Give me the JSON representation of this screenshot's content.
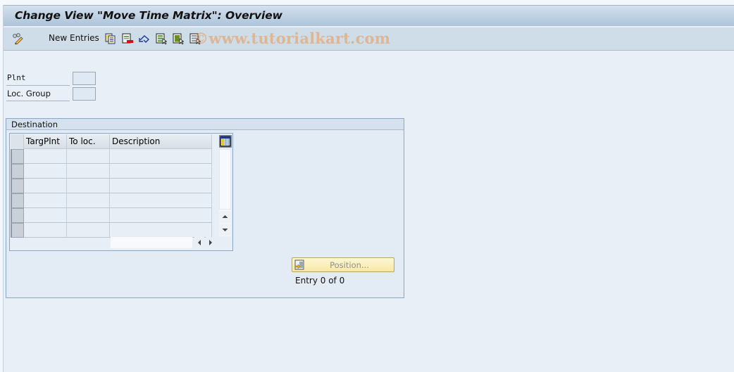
{
  "window": {
    "title": "Change View \"Move Time Matrix\": Overview"
  },
  "toolbar": {
    "items": [
      {
        "icon": "display-change-icon",
        "label": ""
      },
      {
        "icon": "new-entries",
        "label": "New Entries"
      },
      {
        "icon": "copy-icon",
        "label": ""
      },
      {
        "icon": "delete-icon",
        "label": ""
      },
      {
        "icon": "undo-change-icon",
        "label": ""
      },
      {
        "icon": "select-all-icon",
        "label": ""
      },
      {
        "icon": "select-block-icon",
        "label": ""
      },
      {
        "icon": "deselect-all-icon",
        "label": ""
      }
    ],
    "new_entries_label": "New Entries"
  },
  "watermark": "©www.tutorialkart.com",
  "fields": {
    "plant": {
      "label": "Plnt",
      "value": ""
    },
    "loc_group": {
      "label": "Loc. Group",
      "value": ""
    }
  },
  "destination": {
    "title": "Destination",
    "columns": [
      "TargPlnt",
      "To loc.",
      "Description"
    ],
    "rows": [
      [
        "",
        "",
        ""
      ],
      [
        "",
        "",
        ""
      ],
      [
        "",
        "",
        ""
      ],
      [
        "",
        "",
        ""
      ],
      [
        "",
        "",
        ""
      ],
      [
        "",
        "",
        ""
      ]
    ],
    "position_button": "Position...",
    "entry_status": "Entry 0 of 0"
  },
  "colors": {
    "title_bar_top": "#d4e1ee",
    "title_bar_bottom": "#adc3da",
    "toolbar": "#cfdde8",
    "background": "#e8eff7",
    "position_button": "#f8e9a8"
  }
}
